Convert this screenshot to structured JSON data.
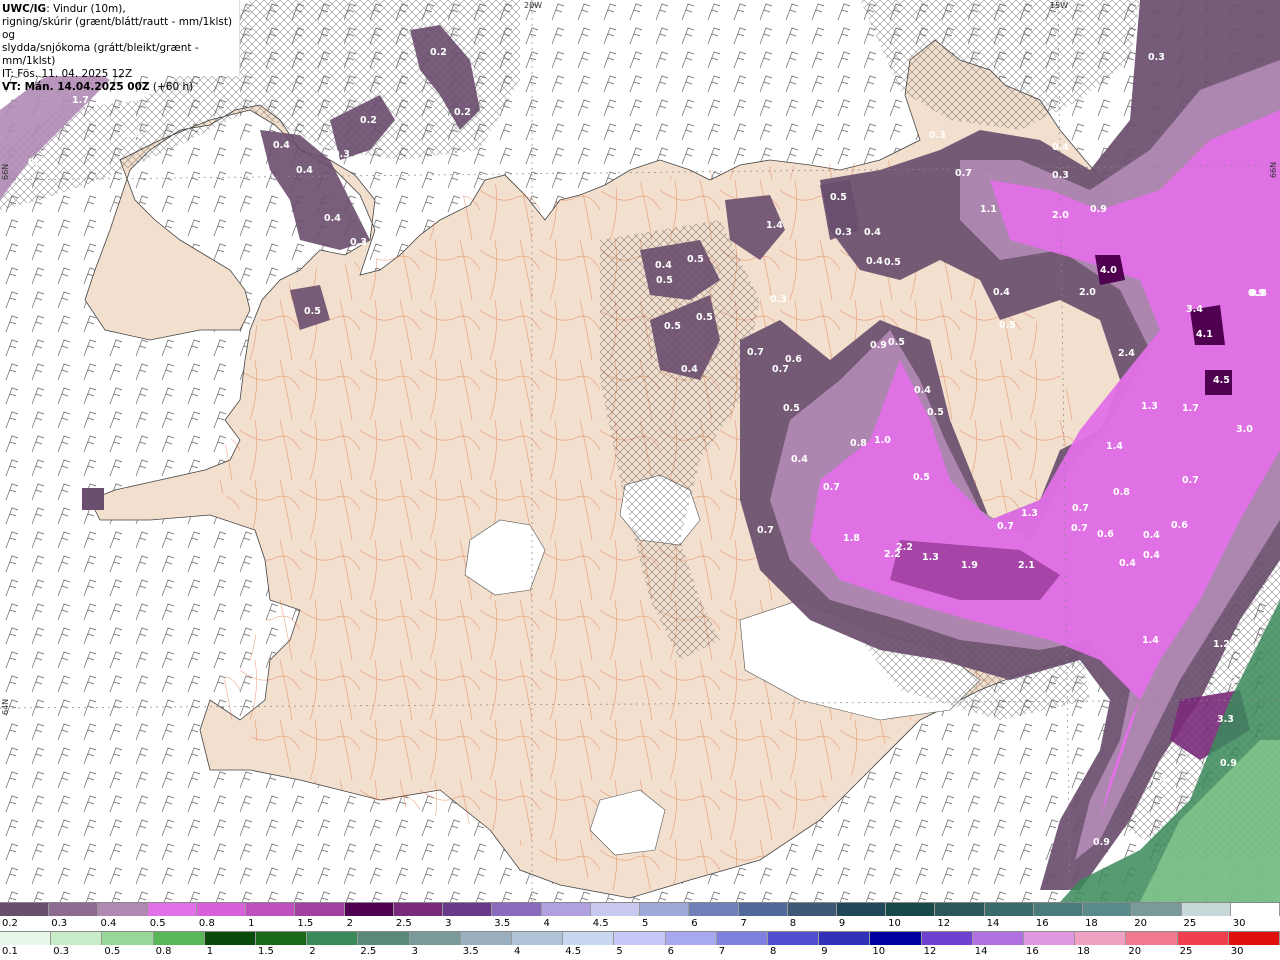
{
  "header": {
    "prefix": "UWC/IG",
    "line1_rest": ": Vindur (10m),",
    "line2": "rigning/skúrir (grænt/blátt/rautt - mm/1klst) og",
    "line3": "slydda/snjókoma (grátt/bleikt/grænt - mm/1klst)",
    "line4": "IT: Fös. 11. 04. 2025 12Z",
    "line5_bold": "VT: Mán. 14.04.2025 00Z",
    "line5_rest": " (+60 h)"
  },
  "grid_labels": {
    "lon_20w": "20W",
    "lon_15w": "15W",
    "lat_66n_left": "66N",
    "lat_66n_right": "66N",
    "lat_64n_left": "64N"
  },
  "map_values": [
    {
      "text": "1.7"
    },
    {
      "text": "0.7"
    },
    {
      "text": "0.2"
    },
    {
      "text": "0.2"
    },
    {
      "text": "0.2"
    },
    {
      "text": "0.4"
    },
    {
      "text": "0.3"
    },
    {
      "text": "0.4"
    },
    {
      "text": "0.4"
    },
    {
      "text": "0.3"
    },
    {
      "text": "0.5"
    },
    {
      "text": "0.2"
    },
    {
      "text": "0.3"
    },
    {
      "text": "0.4"
    },
    {
      "text": "0.5"
    },
    {
      "text": "0.5"
    },
    {
      "text": "0.5"
    },
    {
      "text": "0.5"
    },
    {
      "text": "0.4"
    },
    {
      "text": "1.4"
    },
    {
      "text": "0.5"
    },
    {
      "text": "0.3"
    },
    {
      "text": "0.4"
    },
    {
      "text": "0.4"
    },
    {
      "text": "0.5"
    },
    {
      "text": "0.3"
    },
    {
      "text": "0.3"
    },
    {
      "text": "0.7"
    },
    {
      "text": "0.4"
    },
    {
      "text": "0.3"
    },
    {
      "text": "1.1"
    },
    {
      "text": "2.0"
    },
    {
      "text": "0.9"
    },
    {
      "text": "4.0"
    },
    {
      "text": "2.0"
    },
    {
      "text": "0.4"
    },
    {
      "text": "0.5"
    },
    {
      "text": "0.8"
    },
    {
      "text": "3.4"
    },
    {
      "text": "4.1"
    },
    {
      "text": "2.4"
    },
    {
      "text": "4.5"
    },
    {
      "text": "1.3"
    },
    {
      "text": "1.7"
    },
    {
      "text": "3.0"
    },
    {
      "text": "0.7"
    },
    {
      "text": "0.6"
    },
    {
      "text": "0.7"
    },
    {
      "text": "0.9"
    },
    {
      "text": "0.5"
    },
    {
      "text": "0.5"
    },
    {
      "text": "0.4"
    },
    {
      "text": "0.5"
    },
    {
      "text": "0.8"
    },
    {
      "text": "1.0"
    },
    {
      "text": "0.4"
    },
    {
      "text": "0.5"
    },
    {
      "text": "0.7"
    },
    {
      "text": "1.4"
    },
    {
      "text": "0.8"
    },
    {
      "text": "0.7"
    },
    {
      "text": "0.7"
    },
    {
      "text": "0.6"
    },
    {
      "text": "0.4"
    },
    {
      "text": "0.7"
    },
    {
      "text": "1.8"
    },
    {
      "text": "2.2"
    },
    {
      "text": "2.2"
    },
    {
      "text": "1.3"
    },
    {
      "text": "1.9"
    },
    {
      "text": "2.1"
    },
    {
      "text": "1.3"
    },
    {
      "text": "0.7"
    },
    {
      "text": "0.4"
    },
    {
      "text": "0.4"
    },
    {
      "text": "0.6"
    },
    {
      "text": "1.4"
    },
    {
      "text": "1.2"
    },
    {
      "text": "1.2"
    },
    {
      "text": "3.3"
    },
    {
      "text": "0.9"
    },
    {
      "text": "1.1"
    },
    {
      "text": "0.9"
    },
    {
      "text": "0.7"
    },
    {
      "text": "0.9"
    }
  ],
  "legend_snow": {
    "labels": [
      "0.2",
      "0.3",
      "0.4",
      "0.5",
      "0.8",
      "1",
      "1.5",
      "2",
      "2.5",
      "3",
      "3.5",
      "4",
      "4.5",
      "5",
      "6",
      "7",
      "8",
      "9",
      "10",
      "12",
      "14",
      "16",
      "18",
      "20",
      "25",
      "30"
    ],
    "colors": [
      "#6a4e6e",
      "#8d6a90",
      "#b089b2",
      "#e270e8",
      "#d860d8",
      "#c050c0",
      "#a040a0",
      "#500050",
      "#7a2a7a",
      "#6a3a8a",
      "#8a6aba",
      "#b0a0e0",
      "#c8c8f0",
      "#a0a8d8",
      "#7080b8",
      "#50689a",
      "#405878",
      "#204858",
      "#184848",
      "#2a5858",
      "#3a6a6a",
      "#4a7a7a",
      "#5a8a8a",
      "#7a9a9a",
      "#c8d8d8",
      "#ffffff"
    ]
  },
  "legend_rain": {
    "labels": [
      "0.1",
      "0.3",
      "0.5",
      "0.8",
      "1",
      "1.5",
      "2",
      "2.5",
      "3",
      "3.5",
      "4",
      "4.5",
      "5",
      "6",
      "7",
      "8",
      "9",
      "10",
      "12",
      "14",
      "16",
      "18",
      "20",
      "25",
      "30"
    ],
    "colors": [
      "#e8f8e8",
      "#c8ecc8",
      "#98d898",
      "#58b858",
      "#0a4a0a",
      "#1a6a1a",
      "#3a8a5a",
      "#5a8a7a",
      "#7a9a9a",
      "#9ab0c0",
      "#b0c4d8",
      "#c8d8f0",
      "#c8c8f8",
      "#a8a8f0",
      "#8080e0",
      "#5050d0",
      "#3030b8",
      "#0000a0",
      "#7040d0",
      "#b070e0",
      "#e098e0",
      "#f0a0c0",
      "#f07890",
      "#f04050",
      "#e01010"
    ]
  }
}
